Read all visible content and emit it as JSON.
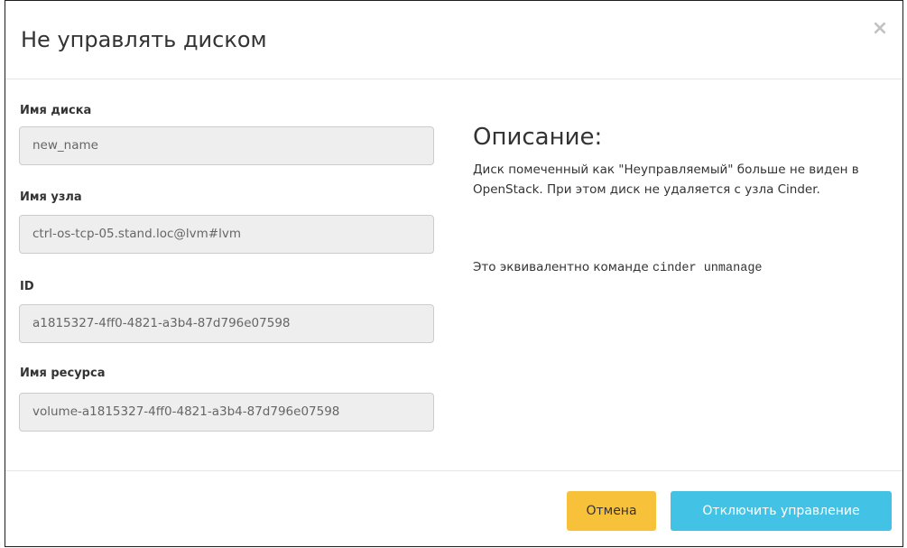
{
  "modal": {
    "title": "Не управлять диском",
    "close_symbol": "×"
  },
  "form": {
    "fields": [
      {
        "label": "Имя диска",
        "value": "new_name"
      },
      {
        "label": "Имя узла",
        "value": "ctrl-os-tcp-05.stand.loc@lvm#lvm"
      },
      {
        "label": "ID",
        "value": "a1815327-4ff0-4821-a3b4-87d796e07598"
      },
      {
        "label": "Имя ресурса",
        "value": "volume-a1815327-4ff0-4821-a3b4-87d796e07598"
      }
    ]
  },
  "description": {
    "title": "Описание:",
    "text": "Диск помеченный как \"Неуправляемый\" больше не виден в OpenStack. При этом диск не удаляется с узла Cinder.",
    "equivalent_prefix": "Это эквивалентно команде ",
    "command": "cinder unmanage"
  },
  "footer": {
    "cancel_label": "Отмена",
    "submit_label": "Отключить управление"
  },
  "colors": {
    "cancel_button": "#f8c13a",
    "submit_button": "#42c3e6",
    "input_background": "#eeeeee",
    "close_icon": "#c2c2c2"
  },
  "icons": {
    "close": "close-icon"
  }
}
